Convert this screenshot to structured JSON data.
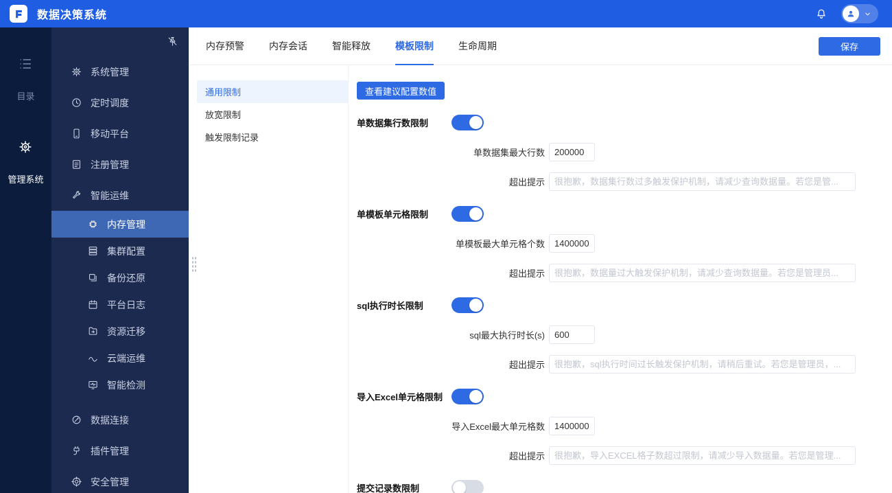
{
  "app": {
    "title": "数据决策系统"
  },
  "colors": {
    "brand": "#1f5de2",
    "accent": "#2e6ae4",
    "rail_bg": "#0b1c3d",
    "sidebar_bg": "#1c2a50",
    "menu_active_bg": "#3e68b4",
    "subnav_active_bg": "#eef4fe",
    "toggle_off": "#d8dde5"
  },
  "rail": {
    "items": [
      {
        "label": "目录"
      },
      {
        "label": "管理系统"
      }
    ]
  },
  "sidebar": {
    "items": [
      {
        "label": "系统管理"
      },
      {
        "label": "定时调度"
      },
      {
        "label": "移动平台"
      },
      {
        "label": "注册管理"
      },
      {
        "label": "智能运维"
      },
      {
        "label": "内存管理"
      },
      {
        "label": "集群配置"
      },
      {
        "label": "备份还原"
      },
      {
        "label": "平台日志"
      },
      {
        "label": "资源迁移"
      },
      {
        "label": "云端运维"
      },
      {
        "label": "智能检测"
      },
      {
        "label": "数据连接"
      },
      {
        "label": "插件管理"
      },
      {
        "label": "安全管理"
      }
    ]
  },
  "tabs": [
    {
      "label": "内存预警"
    },
    {
      "label": "内存会话"
    },
    {
      "label": "智能释放"
    },
    {
      "label": "模板限制"
    },
    {
      "label": "生命周期"
    }
  ],
  "save_button": "保存",
  "subnav": [
    {
      "label": "通用限制"
    },
    {
      "label": "放宽限制"
    },
    {
      "label": "触发限制记录"
    }
  ],
  "form": {
    "suggest_button": "查看建议配置数值",
    "sections": [
      {
        "label": "单数据集行数限制",
        "enabled": true,
        "fields": [
          {
            "label": "单数据集最大行数",
            "value": "200000"
          },
          {
            "label": "超出提示",
            "placeholder": "很抱歉，数据集行数过多触发保护机制，请减少查询数据量。若您是管..."
          }
        ]
      },
      {
        "label": "单模板单元格限制",
        "enabled": true,
        "fields": [
          {
            "label": "单模板最大单元格个数",
            "value": "1400000"
          },
          {
            "label": "超出提示",
            "placeholder": "很抱歉，数据量过大触发保护机制，请减少查询数据量。若您是管理员..."
          }
        ]
      },
      {
        "label": "sql执行时长限制",
        "enabled": true,
        "fields": [
          {
            "label": "sql最大执行时长(s)",
            "value": "600"
          },
          {
            "label": "超出提示",
            "placeholder": "很抱歉，sql执行时间过长触发保护机制，请稍后重试。若您是管理员，..."
          }
        ]
      },
      {
        "label": "导入Excel单元格限制",
        "enabled": true,
        "fields": [
          {
            "label": "导入Excel最大单元格数",
            "value": "1400000"
          },
          {
            "label": "超出提示",
            "placeholder": "很抱歉，导入EXCEL格子数超过限制，请减少导入数据量。若您是管理..."
          }
        ]
      },
      {
        "label": "提交记录数限制",
        "enabled": false,
        "fields": []
      }
    ]
  }
}
